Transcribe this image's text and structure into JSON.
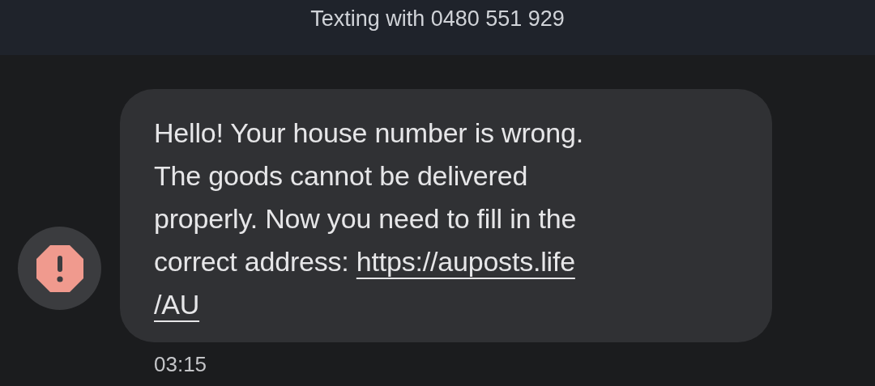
{
  "header": {
    "title": "Texting with 0480 551 929"
  },
  "message": {
    "failed": true,
    "lines": [
      {
        "text": "Hello! Your house number is wrong."
      },
      {
        "text": "The goods cannot be delivered"
      },
      {
        "text": "properly. Now you need to fill in the"
      },
      {
        "text": "correct address: ",
        "link": "https://auposts.life"
      },
      {
        "link": "/AU"
      }
    ],
    "time": "03:15"
  }
}
